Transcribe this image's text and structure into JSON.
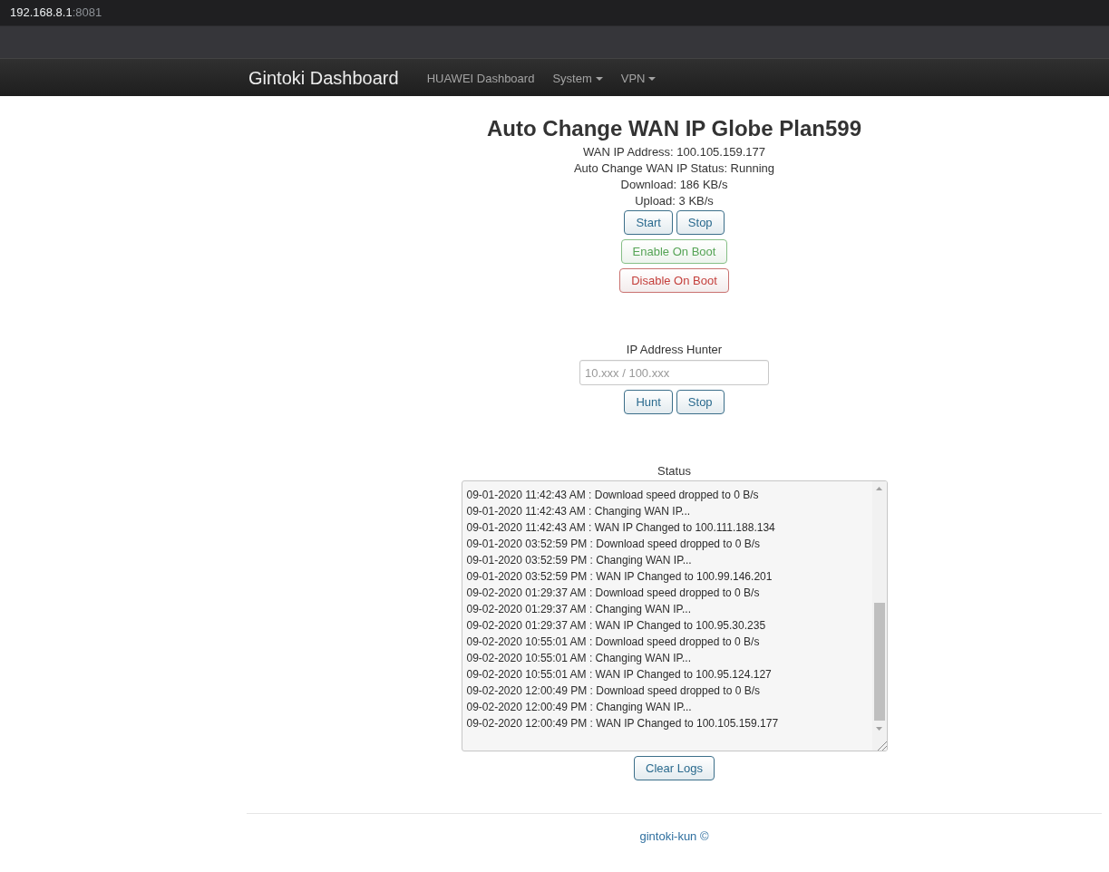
{
  "browser": {
    "address_host": "192.168.8.1",
    "address_port": ":8081"
  },
  "navbar": {
    "brand": "Gintoki Dashboard",
    "items": [
      {
        "label": "HUAWEI Dashboard",
        "dropdown": false
      },
      {
        "label": "System",
        "dropdown": true
      },
      {
        "label": "VPN",
        "dropdown": true
      }
    ]
  },
  "title": "Auto Change WAN IP Globe Plan599",
  "info": [
    "WAN IP Address: 100.105.159.177",
    "Auto Change WAN IP Status: Running",
    "Download: 186 KB/s",
    "Upload: 3 KB/s"
  ],
  "controls": [
    [
      {
        "label": "Start",
        "kind": "default"
      },
      {
        "label": "Stop",
        "kind": "default"
      }
    ],
    [
      {
        "label": "Enable On Boot",
        "kind": "success"
      }
    ],
    [
      {
        "label": "Disable On Boot",
        "kind": "danger"
      }
    ]
  ],
  "hunter": {
    "label": "IP Address Hunter",
    "placeholder": "10.xxx / 100.xxx",
    "buttons": [
      {
        "label": "Hunt",
        "kind": "default"
      },
      {
        "label": "Stop",
        "kind": "default"
      }
    ]
  },
  "status": {
    "label": "Status",
    "log": [
      "09-01-2020 11:42:43 AM : Download speed dropped to 0 B/s",
      "09-01-2020 11:42:43 AM : Changing WAN IP...",
      "09-01-2020 11:42:43 AM : WAN IP Changed to 100.111.188.134",
      "09-01-2020 03:52:59 PM : Download speed dropped to 0 B/s",
      "09-01-2020 03:52:59 PM : Changing WAN IP...",
      "09-01-2020 03:52:59 PM : WAN IP Changed to 100.99.146.201",
      "09-02-2020 01:29:37 AM : Download speed dropped to 0 B/s",
      "09-02-2020 01:29:37 AM : Changing WAN IP...",
      "09-02-2020 01:29:37 AM : WAN IP Changed to 100.95.30.235",
      "09-02-2020 10:55:01 AM : Download speed dropped to 0 B/s",
      "09-02-2020 10:55:01 AM : Changing WAN IP...",
      "09-02-2020 10:55:01 AM : WAN IP Changed to 100.95.124.127",
      "09-02-2020 12:00:49 PM : Download speed dropped to 0 B/s",
      "09-02-2020 12:00:49 PM : Changing WAN IP...",
      "09-02-2020 12:00:49 PM : WAN IP Changed to 100.105.159.177"
    ],
    "clear_button": {
      "label": "Clear Logs",
      "kind": "default"
    }
  },
  "footer": {
    "text": "gintoki-kun ©"
  }
}
